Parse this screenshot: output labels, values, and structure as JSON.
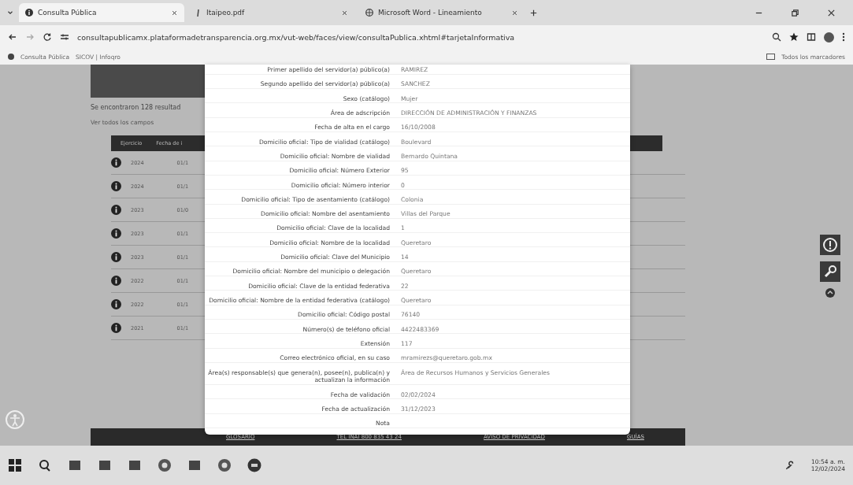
{
  "tabs": [
    {
      "label": "Consulta Pública",
      "selected": true
    },
    {
      "label": "Itaipeo.pdf",
      "selected": false
    },
    {
      "label": "Microsoft Word - Lineamiento",
      "selected": false
    }
  ],
  "address": "consultapublicamx.plataformadetransparencia.org.mx/vut-web/faces/view/consultaPublica.xhtml#tarjetaInformativa",
  "bookmarks": [
    "Consulta Pública",
    "SICOV | Infoqro"
  ],
  "all_bookmarks": "Todos los marcadores",
  "page": {
    "results": "Se encontraron 128 resultad",
    "see_all": "Ver todos los campos",
    "columns": [
      "Ejercicio",
      "Fecha de i"
    ],
    "rows": [
      {
        "year": "2024",
        "date": "01/1"
      },
      {
        "year": "2024",
        "date": "01/1"
      },
      {
        "year": "2023",
        "date": "01/0"
      },
      {
        "year": "2023",
        "date": "01/1"
      },
      {
        "year": "2023",
        "date": "01/1"
      },
      {
        "year": "2022",
        "date": "01/1"
      },
      {
        "year": "2022",
        "date": "01/1"
      },
      {
        "year": "2021",
        "date": "01/1"
      }
    ],
    "footer": [
      "GLOSARIO",
      "TEL INAI 800 835 43 24",
      "AVISO DE PRIVACIDAD",
      "GUÍAS"
    ]
  },
  "modal": {
    "fields": [
      {
        "label": "Primer apellido del servidor(a) público(a)",
        "value": "RAMIREZ"
      },
      {
        "label": "Segundo apellido del servidor(a) público(a)",
        "value": "SANCHEZ"
      },
      {
        "label": "Sexo (catálogo)",
        "value": "Mujer"
      },
      {
        "label": "Área de adscripción",
        "value": "DIRECCIÓN DE ADMINISTRACIÓN Y FINANZAS"
      },
      {
        "label": "Fecha de alta en el cargo",
        "value": "16/10/2008"
      },
      {
        "label": "Domicilio oficial: Tipo de vialidad (catálogo)",
        "value": "Boulevard"
      },
      {
        "label": "Domicilio oficial: Nombre de vialidad",
        "value": "Bernardo Quintana"
      },
      {
        "label": "Domicilio oficial: Número Exterior",
        "value": "95"
      },
      {
        "label": "Domicilio oficial: Número interior",
        "value": "0"
      },
      {
        "label": "Domicilio oficial: Tipo de asentamiento (catálogo)",
        "value": "Colonia"
      },
      {
        "label": "Domicilio oficial: Nombre del asentamiento",
        "value": "Villas del Parque"
      },
      {
        "label": "Domicilio oficial: Clave de la localidad",
        "value": "1"
      },
      {
        "label": "Domicilio oficial: Nombre de la localidad",
        "value": "Queretaro"
      },
      {
        "label": "Domicilio oficial: Clave del Municipio",
        "value": "14"
      },
      {
        "label": "Domicilio oficial: Nombre del municipio o delegación",
        "value": "Queretaro"
      },
      {
        "label": "Domicilio oficial: Clave de la entidad federativa",
        "value": "22"
      },
      {
        "label": "Domicilio oficial: Nombre de la entidad federativa (catálogo)",
        "value": "Queretaro"
      },
      {
        "label": "Domicilio oficial: Código postal",
        "value": "76140"
      },
      {
        "label": "Número(s) de teléfono oficial",
        "value": "4422483369"
      },
      {
        "label": "Extensión",
        "value": "117"
      },
      {
        "label": "Correo electrónico oficial, en su caso",
        "value": "mramirezs@queretaro.gob.mx"
      },
      {
        "label": "Área(s) responsable(s) que genera(n), posee(n), publica(n) y actualizan la información",
        "value": "Área de Recursos Humanos y Servicios Generales"
      },
      {
        "label": "Fecha de validación",
        "value": "02/02/2024"
      },
      {
        "label": "Fecha de actualización",
        "value": "31/12/2023"
      },
      {
        "label": "Nota"
      }
    ]
  },
  "taskbar": {
    "time": "10:54 a. m.",
    "date": "12/02/2024"
  }
}
